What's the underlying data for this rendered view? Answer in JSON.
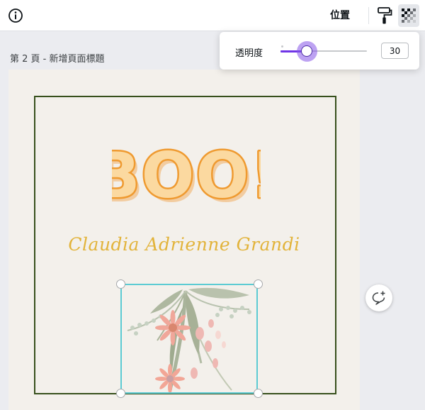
{
  "toolbar": {
    "position_label": "位置",
    "icons": {
      "info": "info-icon",
      "paint": "paint-roller-icon",
      "transparency": "transparency-checker-icon"
    }
  },
  "page": {
    "title": "第 2 頁 - 新增頁面標題"
  },
  "design": {
    "headline": "BOO!",
    "signature": "Claudia Adrienne Grandi",
    "colors": {
      "background": "#f3f0eb",
      "frame": "#37501c",
      "headline_fill": "#fbd9a0",
      "headline_stroke": "#ef9a30",
      "signature": "#e2b33a",
      "selection": "#5ccbd3"
    }
  },
  "transparency": {
    "label": "透明度",
    "value": "30",
    "percent": 30,
    "accent": "#6f35e6"
  },
  "comment": {
    "icon": "add-comment-icon"
  }
}
